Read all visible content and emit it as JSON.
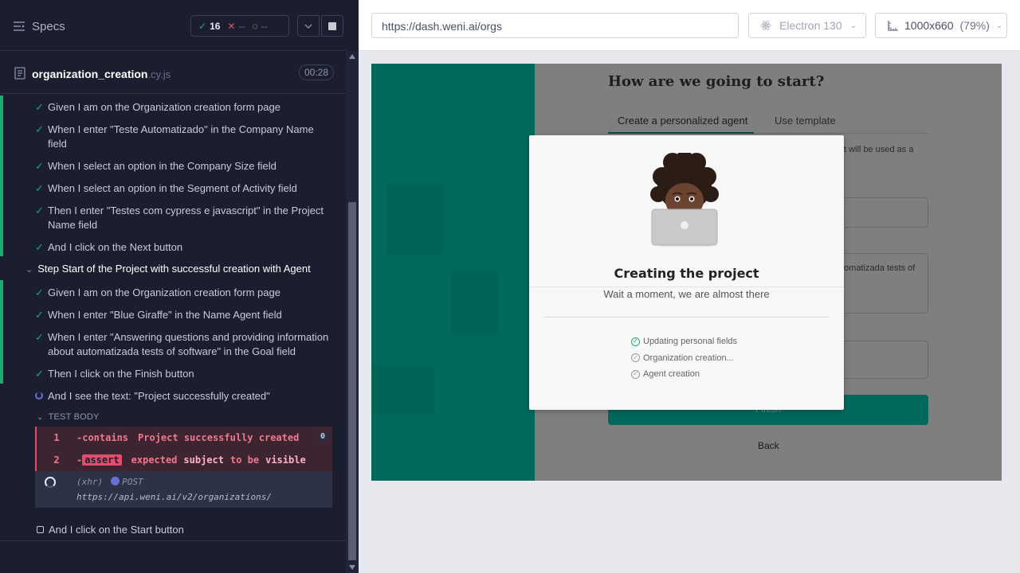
{
  "header": {
    "specs_label": "Specs",
    "passed_count": "16",
    "failed_count": "--",
    "pending_count": "--"
  },
  "spec_file": {
    "name": "organization_creation",
    "ext": ".cy.js",
    "duration": "00:28"
  },
  "steps_group1": [
    "Given I am on the Organization creation form page",
    "When I enter \"Teste Automatizado\" in the Company Name field",
    "When I select an option in the Company Size field",
    "When I select an option in the Segment of Activity field",
    "Then I enter \"Testes com cypress e javascript\" in the Project Name field",
    "And I click on the Next button"
  ],
  "suite_title": "Step Start of the Project with successful creation with Agent",
  "steps_group2": [
    "Given I am on the Organization creation form page",
    "When I enter \"Blue Giraffe\" in the Name Agent field",
    "When I enter \"Answering questions and providing information about automatizada tests of software\" in the Goal field",
    "Then I click on the Finish button",
    "And I see the text: \"Project successfully created\""
  ],
  "test_body_label": "TEST BODY",
  "commands": {
    "c1": {
      "num": "1",
      "name": "-contains",
      "arg": "Project successfully created",
      "count": "0"
    },
    "c2": {
      "num": "2",
      "dash": "-",
      "badge": "assert",
      "w1": "expected",
      "w2": "subject",
      "w3": "to be",
      "w4": "visible"
    }
  },
  "xhr": {
    "label": "(xhr)",
    "method": "POST",
    "url": "https://api.weni.ai/v2/organizations/"
  },
  "next_step": "And I click on the Start button",
  "browser_bar": {
    "url": "https://dash.weni.ai/orgs",
    "browser": "Electron 130",
    "viewport": "1000x660",
    "zoom": "(79%)"
  },
  "app": {
    "form_title": "How are we going to start?",
    "tab_active": "Create a personalized agent",
    "tab_inactive": "Use template",
    "partial_text_1": "t will be used as a",
    "partial_text_2": "tomatizada tests of",
    "finish_label": "Finish",
    "back_label": "Back"
  },
  "modal": {
    "title": "Creating the project",
    "subtitle": "Wait a moment, we are almost there",
    "progress": [
      {
        "label": "Updating personal fields",
        "done": true
      },
      {
        "label": "Organization creation...",
        "done": false
      },
      {
        "label": "Agent creation",
        "done": false
      }
    ]
  },
  "colors": {
    "pass_green": "#1fa971",
    "fail_red": "#e44b6e",
    "weni_teal": "#00695c",
    "pending_purple": "#6a6fd6"
  }
}
